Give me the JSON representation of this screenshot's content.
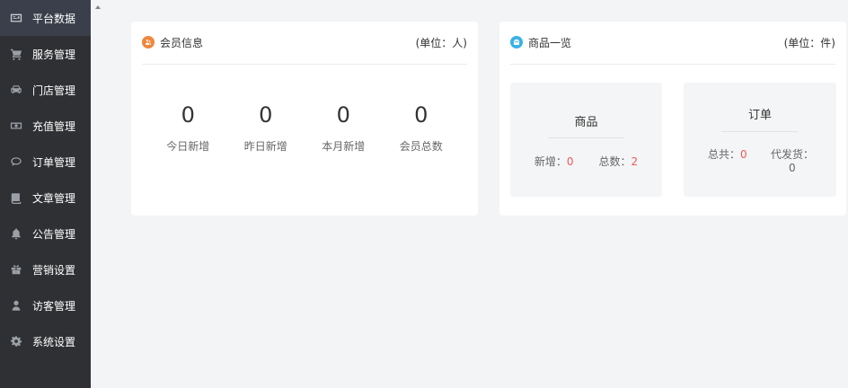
{
  "sidebar": {
    "items": [
      {
        "label": "平台数据",
        "icon": "dashboard-icon",
        "active": true
      },
      {
        "label": "服务管理",
        "icon": "cart-icon"
      },
      {
        "label": "门店管理",
        "icon": "car-icon"
      },
      {
        "label": "充值管理",
        "icon": "money-icon"
      },
      {
        "label": "订单管理",
        "icon": "chat-bubble-icon"
      },
      {
        "label": "文章管理",
        "icon": "book-icon"
      },
      {
        "label": "公告管理",
        "icon": "bell-icon"
      },
      {
        "label": "营销设置",
        "icon": "gift-icon"
      },
      {
        "label": "访客管理",
        "icon": "user-icon"
      },
      {
        "label": "系统设置",
        "icon": "gear-icon"
      }
    ]
  },
  "member_card": {
    "title": "会员信息",
    "unit": "(单位：人)",
    "stats": [
      {
        "value": "0",
        "label": "今日新增"
      },
      {
        "value": "0",
        "label": "昨日新增"
      },
      {
        "value": "0",
        "label": "本月新增"
      },
      {
        "value": "0",
        "label": "会员总数"
      }
    ]
  },
  "goods_card": {
    "title": "商品一览",
    "unit": "(单位：件)",
    "goods": {
      "title": "商品",
      "new_label": "新增：",
      "new_value": "0",
      "total_label": "总数：",
      "total_value": "2"
    },
    "orders": {
      "title": "订单",
      "total_label": "总共：",
      "total_value": "0",
      "pending_label": "代发货：",
      "pending_value": "0"
    }
  },
  "colors": {
    "sidebar_bg": "#2f3033",
    "active_bg": "#3a3f4b",
    "orange_icon": "#f0873d",
    "blue_icon": "#39b3e5",
    "red_value": "#f05a5a"
  }
}
